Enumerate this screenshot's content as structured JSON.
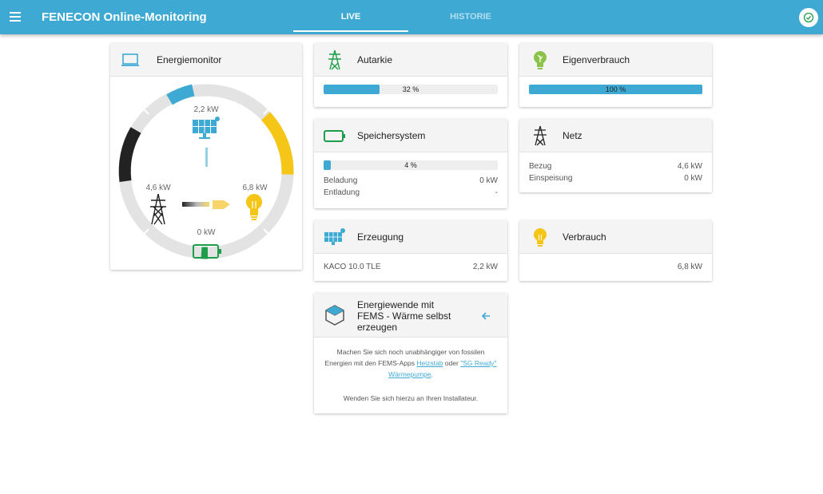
{
  "app": {
    "title": "FENECON Online-Monitoring"
  },
  "tabs": [
    {
      "label": "LIVE",
      "active": true
    },
    {
      "label": "HISTORIE",
      "active": false
    }
  ],
  "colors": {
    "primary": "#3eaad4",
    "consumption": "#f5c518",
    "storage": "#1e9e4a",
    "grid": "#222222",
    "production": "#3eaad4"
  },
  "energy_monitor": {
    "title": "Energiemonitor",
    "production": "2,2 kW",
    "grid": "4,6 kW",
    "consumption": "6,8 kW",
    "storage": "0 kW",
    "production_ratio": 0.15,
    "consumption_ratio": 0.6,
    "grid_ratio": 0.35,
    "storage_soc": 0.04
  },
  "autarkie": {
    "title": "Autarkie",
    "value_label": "32 %",
    "fraction": 0.32
  },
  "eigenverbrauch": {
    "title": "Eigenverbrauch",
    "value_label": "100 %",
    "fraction": 1.0
  },
  "speichersystem": {
    "title": "Speichersystem",
    "value_label": "4 %",
    "fraction": 0.04,
    "beladung_label": "Beladung",
    "beladung_value": "0 kW",
    "entladung_label": "Entladung",
    "entladung_value": "-"
  },
  "netz": {
    "title": "Netz",
    "bezug_label": "Bezug",
    "bezug_value": "4,6 kW",
    "einspeisung_label": "Einspeisung",
    "einspeisung_value": "0 kW"
  },
  "erzeugung": {
    "title": "Erzeugung",
    "device": "KACO 10.0 TLE",
    "value": "2,2 kW"
  },
  "verbrauch": {
    "title": "Verbrauch",
    "value": "6,8 kW"
  },
  "promo": {
    "title_line1": "Energiewende mit",
    "title_line2": "FEMS - Wärme selbst",
    "title_line3": "erzeugen",
    "text_part1": "Machen Sie sich noch unabhängiger von fossilen Energien mit den FEMS-Apps ",
    "link1": "Heizstab",
    "text_part2": " oder ",
    "link2": "\"SG Ready\" Wärmepumpe",
    "text_part3": ".",
    "text_footer": "Wenden Sie sich hierzu an Ihren Installateur."
  }
}
